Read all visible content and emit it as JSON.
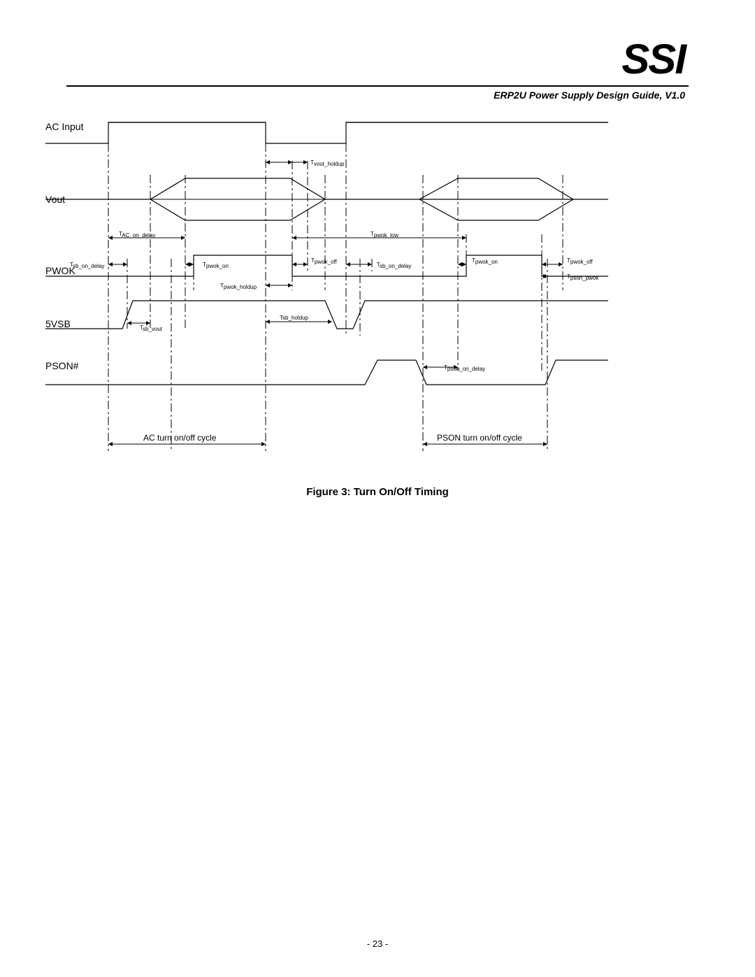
{
  "header": {
    "logo": "SSI",
    "subtitle": "ERP2U Power Supply Design Guide, V1.0"
  },
  "signals": {
    "ac_input": "AC Input",
    "vout": "Vout",
    "pwok": "PWOK",
    "fivevsb": "5VSB",
    "pson": "PSON#"
  },
  "timing": {
    "t_vout_holdup": "T",
    "t_vout_holdup_sub": "vout_holdup",
    "t_ac_on_delay": "T",
    "t_ac_on_delay_sub": "AC_on_delay",
    "t_sb_on_delay": "T",
    "t_sb_on_delay_sub": "sb_on_delay",
    "t_pwok_on": "T",
    "t_pwok_on_sub": "pwok_on",
    "t_pwok_off": "T",
    "t_pwok_off_sub": "pwok_off",
    "t_pwok_holdup": "T",
    "t_pwok_holdup_sub": "pwok_holdup",
    "t_pwok_low": "T",
    "t_pwok_low_sub": "pwok_low",
    "t_sb_on_delay2": "T",
    "t_sb_on_delay2_sub": "sb_on_delay",
    "t_pwok_on2": "T",
    "t_pwok_on2_sub": "pwok_on",
    "t_pwok_off2": "T",
    "t_pwok_off2_sub": "pwok_off",
    "t_pson_pwok": "T",
    "t_pson_pwok_sub": "pson_pwok",
    "t_sb_vout": "T",
    "t_sb_vout_sub": "sb_vout",
    "t_sb_holdup": "Tsb_holdup",
    "t_pson_on_delay": "T",
    "t_pson_on_delay_sub": "pson_on_delay"
  },
  "cycles": {
    "ac": "AC turn on/off cycle",
    "pson": "PSON turn on/off cycle"
  },
  "caption": "Figure 3:  Turn On/Off Timing",
  "footer": {
    "page_number": "- 23 -"
  },
  "chart_data": {
    "type": "timing-diagram",
    "title": "Turn On/Off Timing",
    "signals": [
      {
        "name": "AC Input",
        "edges": [
          {
            "t": 0,
            "v": 0
          },
          {
            "t": 90,
            "v": 0
          },
          {
            "t": 90,
            "v": 1
          },
          {
            "t": 315,
            "v": 1
          },
          {
            "t": 315,
            "v": 0
          },
          {
            "t": 430,
            "v": 0
          },
          {
            "t": 430,
            "v": 1
          },
          {
            "t": 805,
            "v": 1
          }
        ]
      },
      {
        "name": "Vout",
        "shape": "hexagon",
        "segments": [
          {
            "start": 150,
            "ramp_end": 200,
            "hold_end": 350,
            "close": 400
          },
          {
            "start": 535,
            "ramp_end": 590,
            "hold_end": 705,
            "close": 755
          }
        ]
      },
      {
        "name": "PWOK",
        "edges": [
          {
            "t": 0,
            "v": 0
          },
          {
            "t": 212,
            "v": 0
          },
          {
            "t": 212,
            "v": 1
          },
          {
            "t": 353,
            "v": 1
          },
          {
            "t": 353,
            "v": 0
          },
          {
            "t": 602,
            "v": 0
          },
          {
            "t": 602,
            "v": 1
          },
          {
            "t": 710,
            "v": 1
          },
          {
            "t": 712,
            "v": 0
          },
          {
            "t": 805,
            "v": 0
          }
        ]
      },
      {
        "name": "5VSB",
        "edges": [
          {
            "t": 0,
            "v": 0
          },
          {
            "t": 110,
            "v": 0
          },
          {
            "t": 125,
            "v": 1
          },
          {
            "t": 400,
            "v": 1
          },
          {
            "t": 417,
            "v": 0
          },
          {
            "t": 440,
            "v": 0
          },
          {
            "t": 457,
            "v": 1
          },
          {
            "t": 805,
            "v": 1
          }
        ]
      },
      {
        "name": "PSON#",
        "edges": [
          {
            "t": 0,
            "v": 0
          },
          {
            "t": 457,
            "v": 0
          },
          {
            "t": 475,
            "v": 1
          },
          {
            "t": 530,
            "v": 1
          },
          {
            "t": 540,
            "v": 0
          },
          {
            "t": 715,
            "v": 0
          },
          {
            "t": 730,
            "v": 1
          },
          {
            "t": 805,
            "v": 1
          }
        ]
      }
    ],
    "intervals": [
      {
        "name": "T_vout_holdup",
        "from": "AC Input fall",
        "to": "Vout fall",
        "start": 315,
        "end": 400,
        "row": "above Vout"
      },
      {
        "name": "T_AC_on_delay",
        "from": "AC rise",
        "to": "Vout valid",
        "start": 90,
        "end": 200,
        "row": "between Vout/PWOK"
      },
      {
        "name": "T_pwok_low",
        "from": "first PWOK fall",
        "to": "second PWOK rise",
        "start": 353,
        "end": 602,
        "row": "between Vout/PWOK"
      },
      {
        "name": "T_sb_on_delay",
        "from": "AC rise",
        "to": "5VSB rise",
        "start": 90,
        "end": 117,
        "row": "at PWOK"
      },
      {
        "name": "T_pwok_on",
        "from": "Vout valid",
        "to": "PWOK rise",
        "start": 200,
        "end": 212,
        "row": "at PWOK"
      },
      {
        "name": "T_pwok_off",
        "from": "PWOK fall",
        "to": "Vout ramp-down",
        "start": 353,
        "end": 375,
        "row": "at PWOK"
      },
      {
        "name": "T_pwok_holdup",
        "from": "AC fall",
        "to": "PWOK fall",
        "start": 315,
        "end": 353,
        "row": "below PWOK"
      },
      {
        "name": "T_sb_on_delay (2)",
        "from": "AC rise 2",
        "to": "5VSB rise 2",
        "start": 430,
        "end": 450,
        "row": "at PWOK"
      },
      {
        "name": "T_pwok_on (2)",
        "from": "Vout valid 2",
        "to": "PWOK rise 2",
        "start": 590,
        "end": 602,
        "row": "at PWOK"
      },
      {
        "name": "T_pwok_off (2)",
        "from": "PWOK fall 2",
        "to": "Vout ramp-down 2",
        "start": 710,
        "end": 730,
        "row": "at PWOK"
      },
      {
        "name": "T_pson_pwok",
        "from": "PWOK fall 2",
        "to": "PSON# rise 2",
        "start": 710,
        "end": 718,
        "row": "at PWOK"
      },
      {
        "name": "T_sb_vout",
        "from": "5VSB rise",
        "to": "Vout rise",
        "start": 117,
        "end": 150,
        "row": "at 5VSB"
      },
      {
        "name": "Tsb_holdup",
        "from": "AC fall",
        "to": "5VSB fall",
        "start": 315,
        "end": 410,
        "row": "at 5VSB"
      },
      {
        "name": "T_pson_on_delay",
        "from": "PSON# fall",
        "to": "Vout rise 2",
        "start": 540,
        "end": 590,
        "row": "at PSON#"
      }
    ],
    "cycle_spans": [
      {
        "name": "AC turn on/off cycle",
        "start": 90,
        "end": 315
      },
      {
        "name": "PSON turn on/off cycle",
        "start": 540,
        "end": 718
      }
    ]
  }
}
